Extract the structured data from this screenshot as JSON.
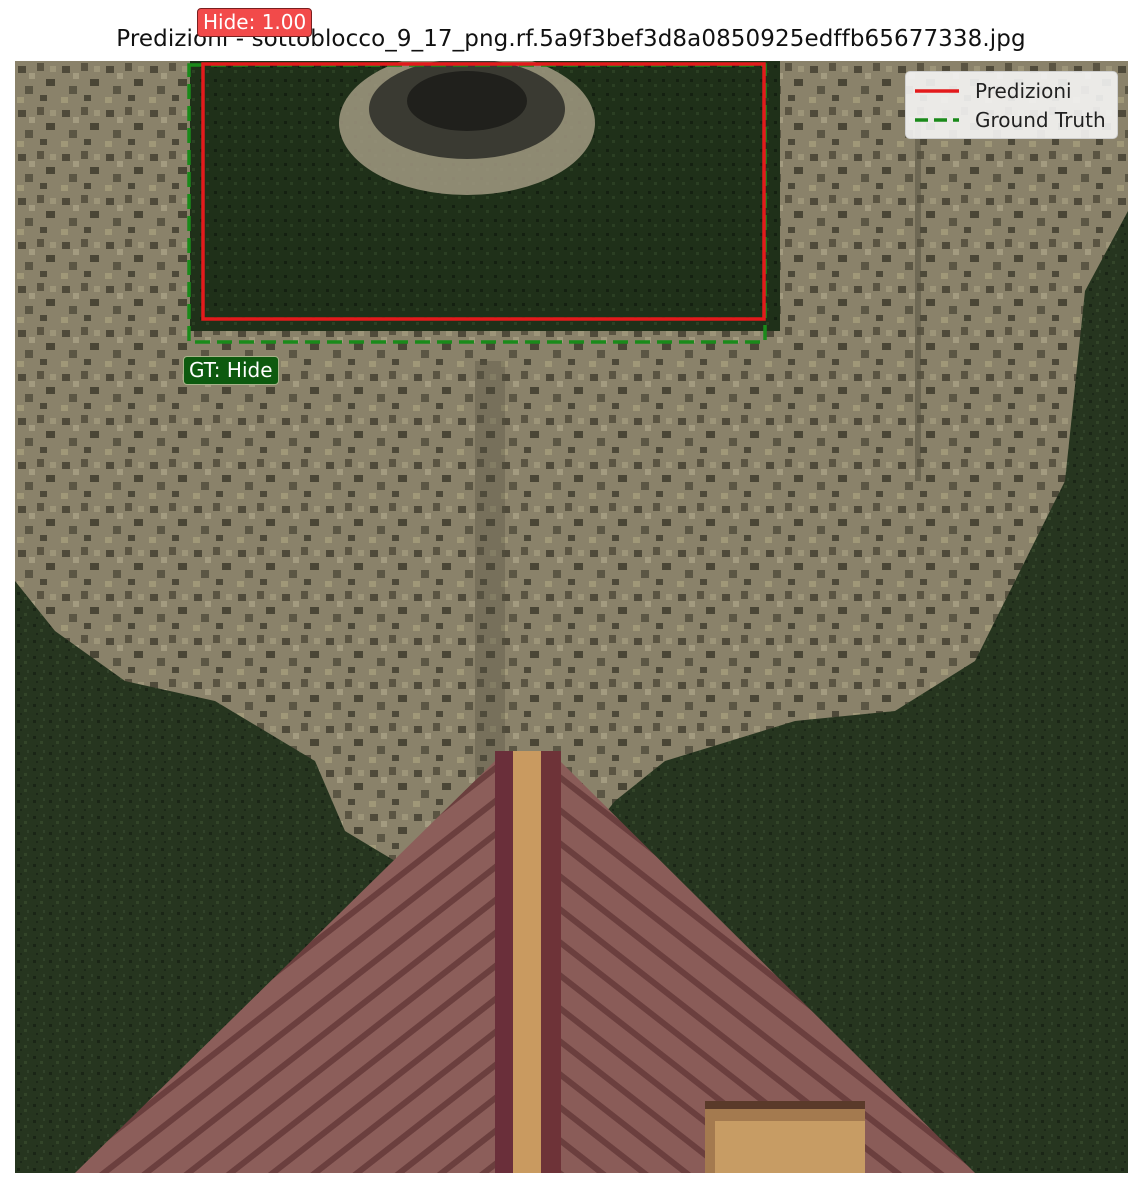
{
  "figure": {
    "title": "Predizioni - sottoblocco_9_17_png.rf.5a9f3bef3d8a0850925edffb65677338.jpg"
  },
  "annotations": {
    "prediction_label": "Hide: 1.00",
    "ground_truth_label": "GT: Hide"
  },
  "legend": {
    "items": [
      {
        "label": "Predizioni",
        "color": "#e31a1c",
        "style": "solid"
      },
      {
        "label": "Ground Truth",
        "color": "#1a8a1a",
        "style": "dashed"
      }
    ]
  },
  "colors": {
    "prediction_box": "#e31a1c",
    "ground_truth_box": "#1a8a1a",
    "prediction_badge": "#f24a4a",
    "ground_truth_badge": "#0d5a0f"
  }
}
